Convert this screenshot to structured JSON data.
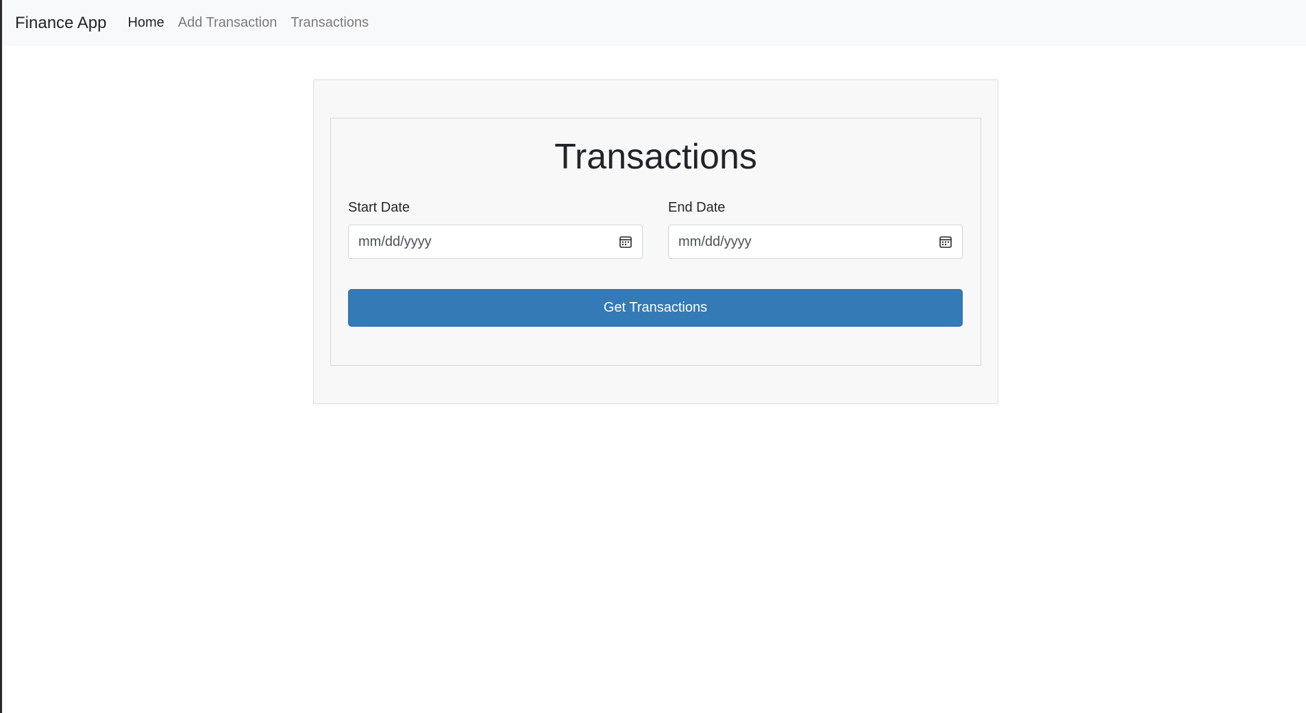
{
  "navbar": {
    "brand": "Finance App",
    "links": [
      {
        "label": "Home",
        "active": true
      },
      {
        "label": "Add Transaction",
        "active": false
      },
      {
        "label": "Transactions",
        "active": false
      }
    ]
  },
  "page": {
    "title": "Transactions",
    "start_date": {
      "label": "Start Date",
      "placeholder": "mm/dd/yyyy",
      "icon": "calendar-icon"
    },
    "end_date": {
      "label": "End Date",
      "placeholder": "mm/dd/yyyy",
      "icon": "calendar-icon"
    },
    "submit_label": "Get Transactions"
  },
  "colors": {
    "navbar_bg": "#f8f9fa",
    "primary_button": "#337ab7",
    "card_bg": "#f8f8f8"
  }
}
